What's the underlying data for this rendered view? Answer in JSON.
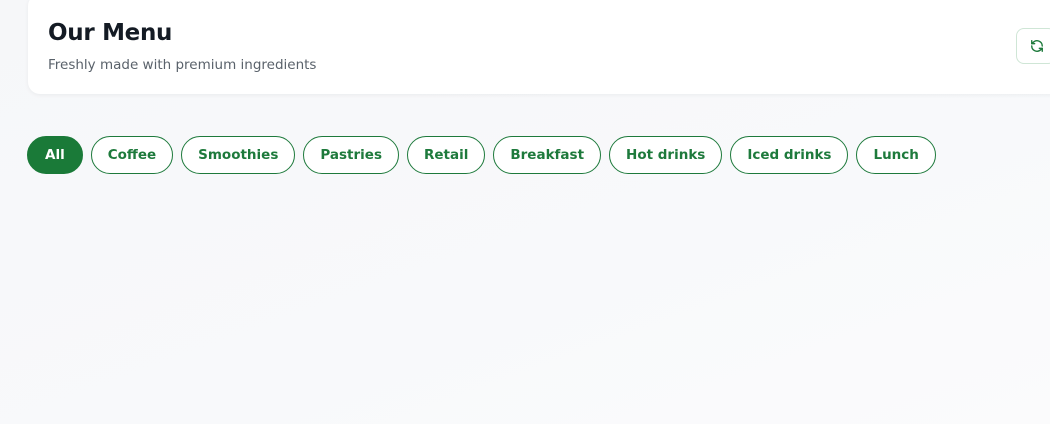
{
  "header": {
    "title": "Our Menu",
    "subtitle": "Freshly made with premium ingredients",
    "refresh_icon": "refresh-icon"
  },
  "filters": {
    "active": "All",
    "items": [
      {
        "label": "All"
      },
      {
        "label": "Coffee"
      },
      {
        "label": "Smoothies"
      },
      {
        "label": "Pastries"
      },
      {
        "label": "Retail"
      },
      {
        "label": "Breakfast"
      },
      {
        "label": "Hot drinks"
      },
      {
        "label": "Iced drinks"
      },
      {
        "label": "Lunch"
      }
    ]
  },
  "colors": {
    "accent": "#1a7a38",
    "title": "#141b24",
    "subtitle": "#5a626b",
    "background": "#f7f8fa"
  }
}
